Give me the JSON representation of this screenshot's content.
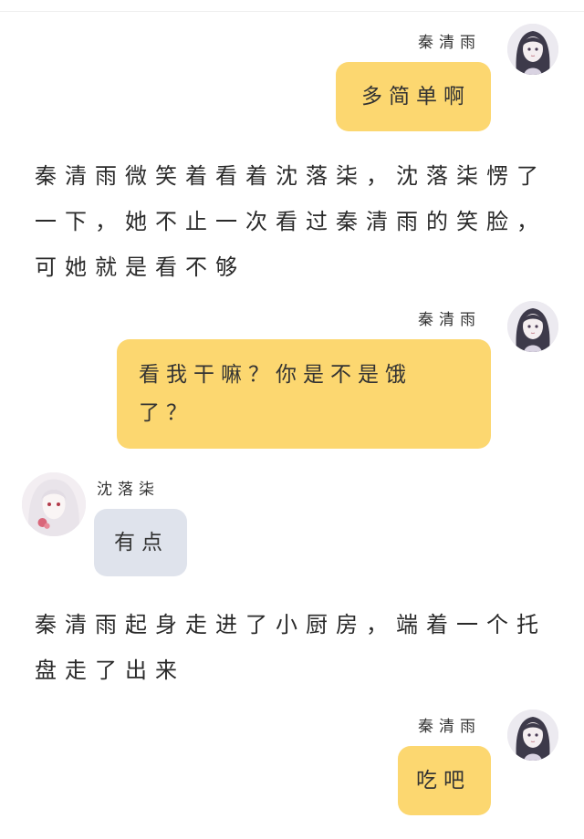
{
  "messages": [
    {
      "speaker": "秦清雨",
      "text": "多简单啊",
      "side": "right",
      "bubble_color": "#fcd770"
    },
    {
      "speaker": "秦清雨",
      "text": "看我干嘛？你是不是饿了？",
      "side": "right",
      "bubble_color": "#fcd770"
    },
    {
      "speaker": "沈落柒",
      "text": "有点",
      "side": "left",
      "bubble_color": "#dfe3ec"
    },
    {
      "speaker": "秦清雨",
      "text": "吃吧",
      "side": "right",
      "bubble_color": "#fcd770"
    }
  ],
  "narration": [
    "秦清雨微笑着看着沈落柒，沈落柒愣了一下，她不止一次看过秦清雨的笑脸，可她就是看不够",
    "秦清雨起身走进了小厨房，端着一个托盘走了出来"
  ],
  "avatars": [
    {
      "icon": "character-avatar-dark-hair"
    },
    {
      "icon": "character-avatar-white-hair"
    }
  ]
}
